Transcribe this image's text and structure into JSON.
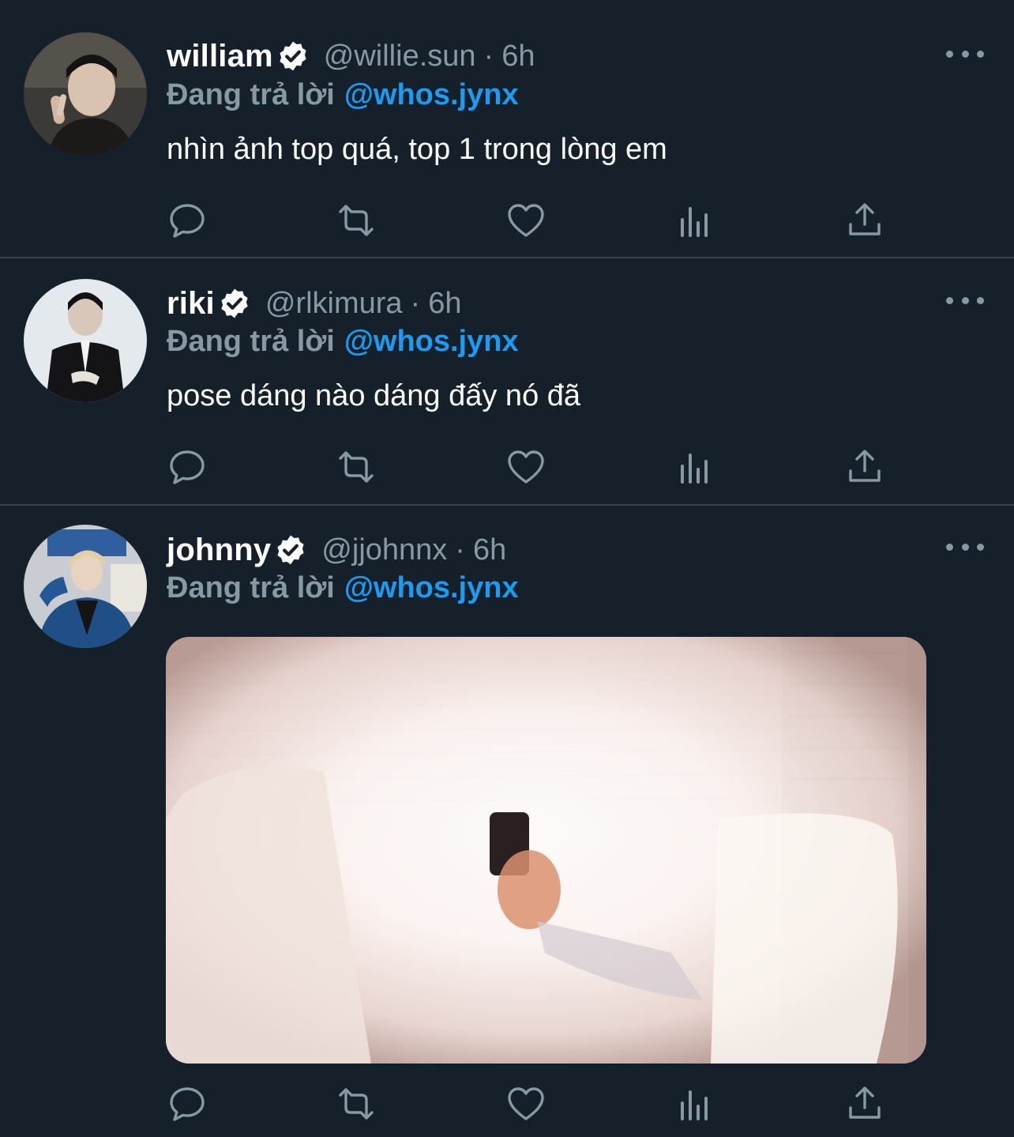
{
  "tweets": [
    {
      "name": "william",
      "handle": "@willie.sun",
      "separator": "·",
      "time": "6h",
      "reply_label": "Đang trả lời",
      "reply_to": "@whos.jynx",
      "text": "nhìn ảnh top quá, top 1 trong lòng em"
    },
    {
      "name": "riki",
      "handle": "@rlkimura",
      "separator": "·",
      "time": "6h",
      "reply_label": "Đang trả lời",
      "reply_to": "@whos.jynx",
      "text": "pose dáng nào dáng đấy nó đã"
    },
    {
      "name": "johnny",
      "handle": "@jjohnnx",
      "separator": "·",
      "time": "6h",
      "reply_label": "Đang trả lời",
      "reply_to": "@whos.jynx",
      "text": ""
    }
  ],
  "colors": {
    "background": "#15202b",
    "divider": "#38444d",
    "muted": "#8899a6",
    "accent": "#1d9bf0",
    "text": "#ffffff"
  },
  "icons": [
    "more-icon",
    "verified-badge-icon",
    "reply-icon",
    "retweet-icon",
    "like-icon",
    "views-icon",
    "share-icon"
  ]
}
